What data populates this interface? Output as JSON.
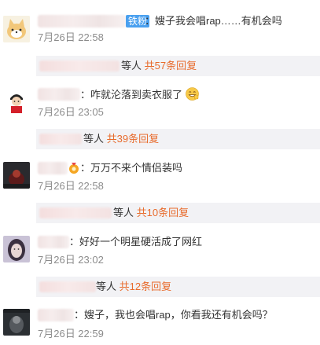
{
  "comments": [
    {
      "badge": "铁粉",
      "text": "：嫂子我会唱rap……有机会吗",
      "time": "7月26日 22:58",
      "reply": {
        "prefix": "等人",
        "count": "共57条回复"
      }
    },
    {
      "text": "：咋就沦落到卖衣服了",
      "emoji": "grin-emoji",
      "time": "7月26日 23:05",
      "reply": {
        "prefix": "等人",
        "count": "共39条回复"
      }
    },
    {
      "text": "：万万不来个情侣装吗",
      "time": "7月26日 22:58",
      "reply": {
        "prefix": "等人",
        "count": "共10条回复"
      }
    },
    {
      "text": "：好好一个明星硬活成了网红",
      "time": "7月26日 23:02",
      "reply": {
        "prefix": "等人",
        "count": "共12条回复"
      }
    },
    {
      "text": "：嫂子，我也会唱rap，你看我还有机会吗？",
      "time": "7月26日 22:59"
    }
  ],
  "colors": {
    "reply_count": "#e86b2c",
    "badge_bg": "#4aa0ef",
    "reply_bg": "#f2f2f5"
  }
}
